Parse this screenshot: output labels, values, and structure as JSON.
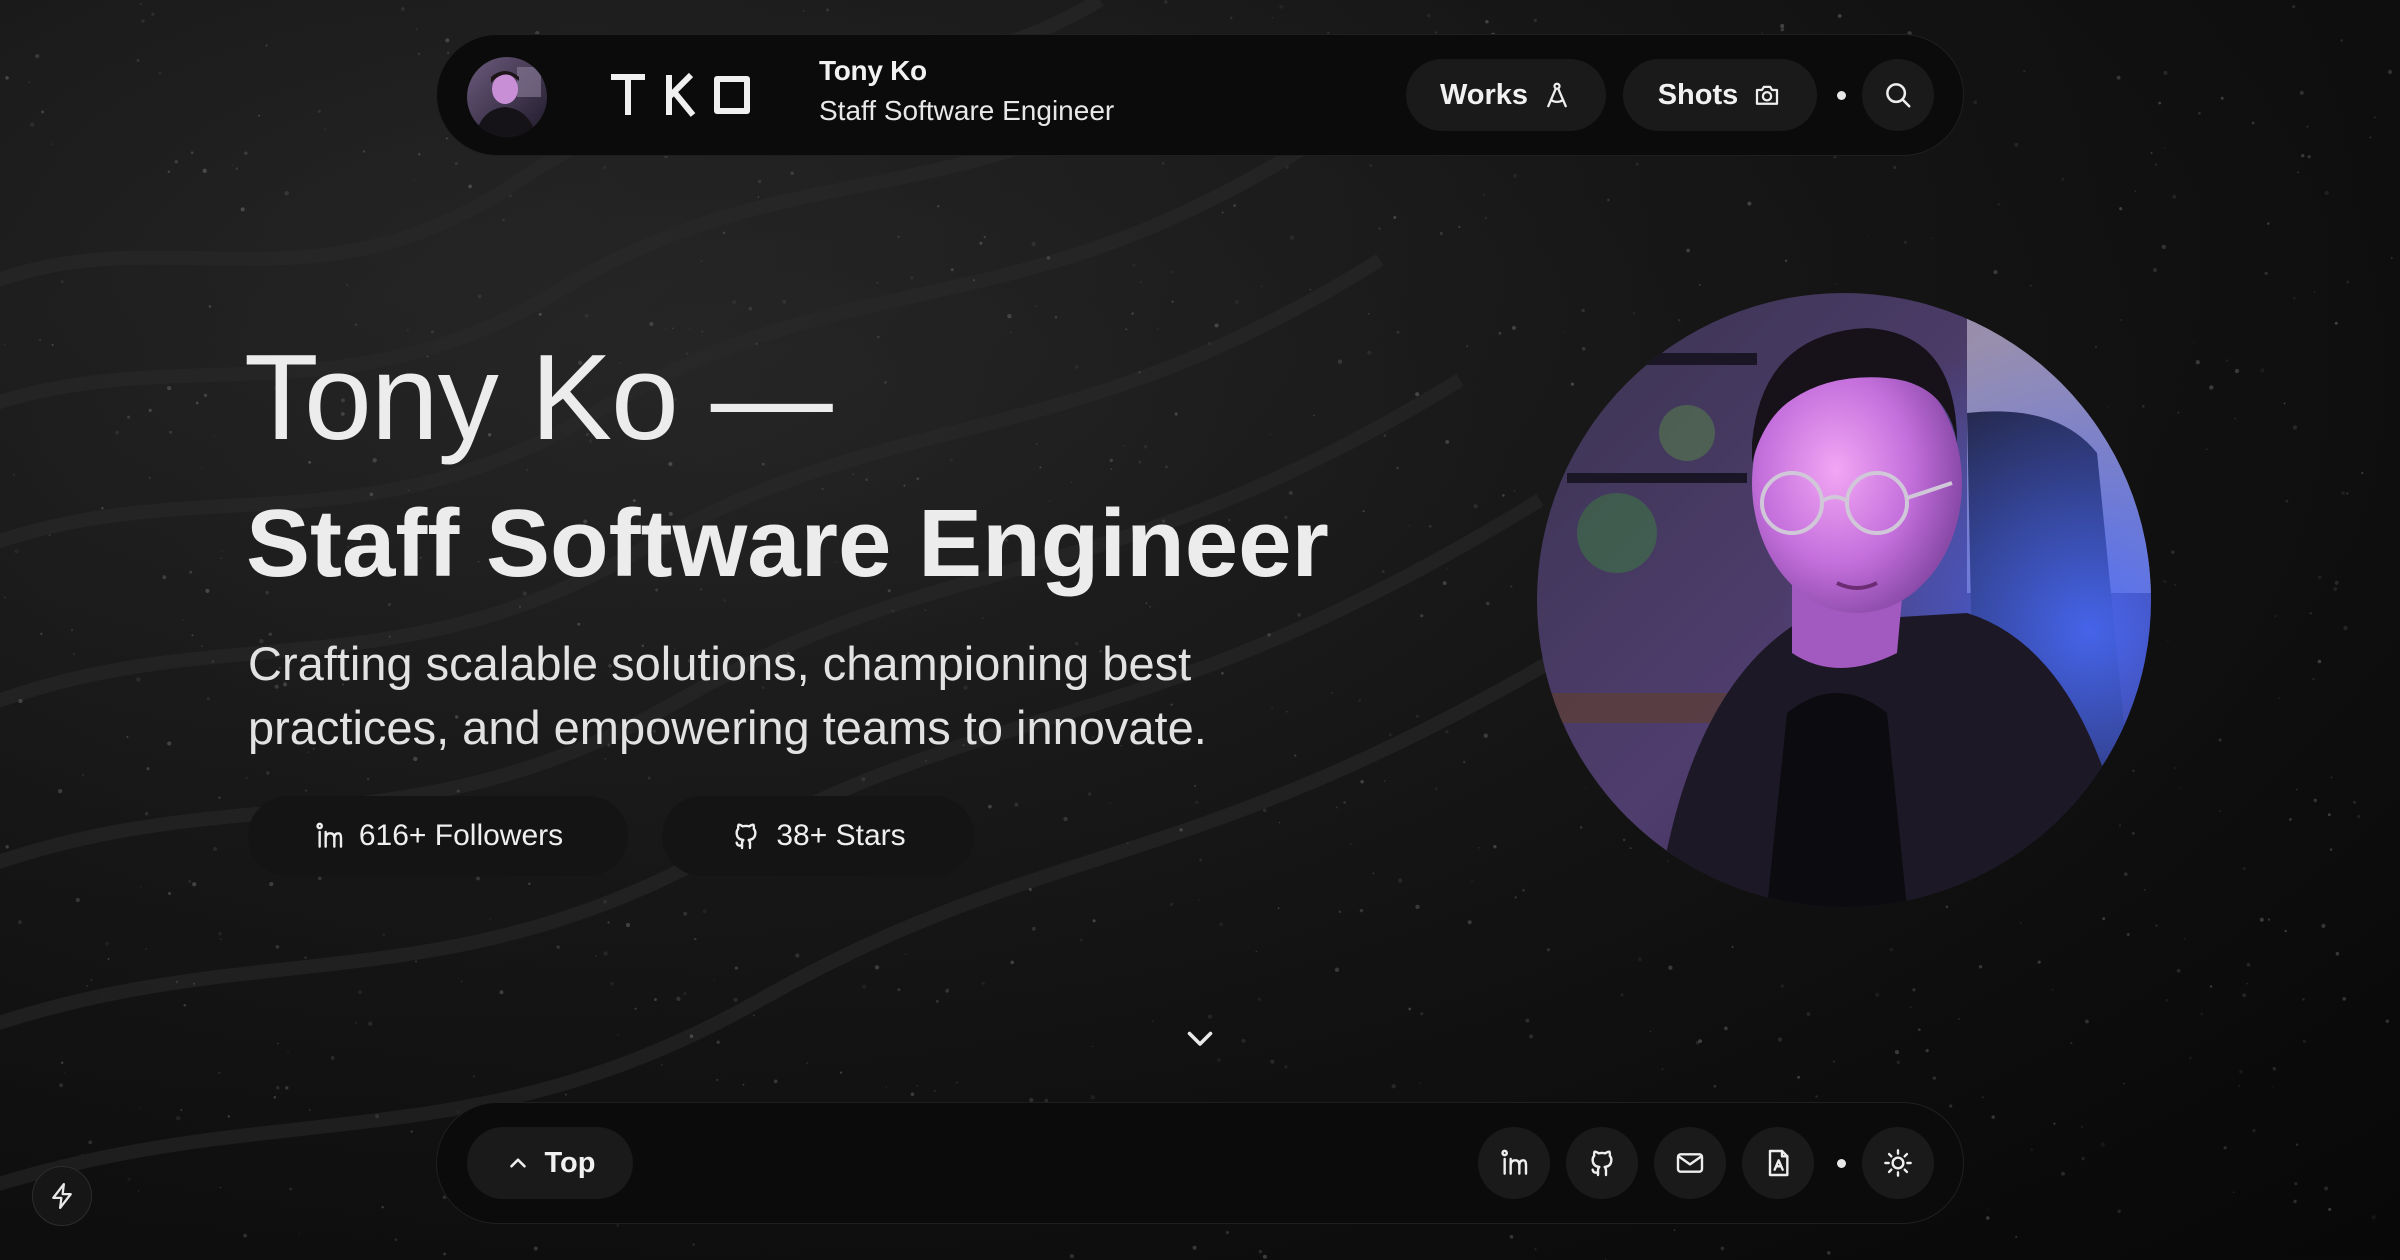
{
  "header": {
    "name": "Tony Ko",
    "role": "Staff Software Engineer",
    "logo_text": "TKO",
    "nav": [
      {
        "label": "Works",
        "icon": "compass-icon"
      },
      {
        "label": "Shots",
        "icon": "camera-icon"
      }
    ],
    "search_icon": "search-icon"
  },
  "hero": {
    "name_line": "Tony Ko —",
    "title_line": "Staff Software Engineer",
    "tagline": "Crafting scalable solutions, championing best practices, and empowering teams to innovate.",
    "stats": [
      {
        "label": "616+ Followers",
        "icon": "linkedin-icon"
      },
      {
        "label": "38+ Stars",
        "icon": "github-icon"
      }
    ]
  },
  "footer": {
    "top_label": "Top",
    "icons": [
      "linkedin-icon",
      "github-icon",
      "mail-icon",
      "resume-icon",
      "sun-icon"
    ]
  },
  "colors": {
    "background": "#111111",
    "bar": "#0b0b0b",
    "pill": "#1a1a1a",
    "text": "#ececec"
  }
}
